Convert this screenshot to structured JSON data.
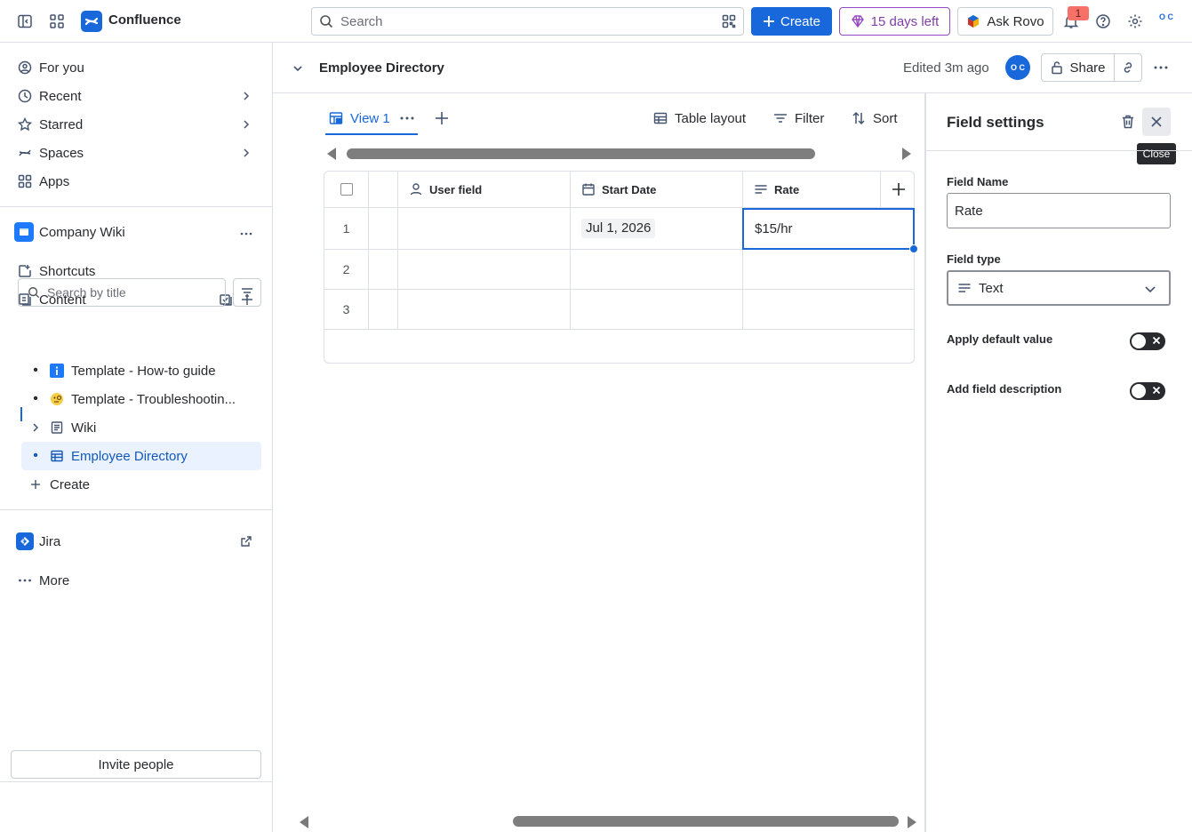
{
  "topbar": {
    "brand": "Confluence",
    "search_placeholder": "Search",
    "create_label": "Create",
    "trial_label": "15 days left",
    "rovo_label": "Ask Rovo",
    "notification_count": "1",
    "avatar_initials": "O C",
    "colors": {
      "primary": "#1868db",
      "trial": "#803fa5",
      "badge": "#f87168"
    }
  },
  "sidebar": {
    "nav": [
      {
        "label": "For you",
        "icon": "user-circle-icon"
      },
      {
        "label": "Recent",
        "icon": "clock-icon"
      },
      {
        "label": "Starred",
        "icon": "star-icon"
      },
      {
        "label": "Spaces",
        "icon": "spaces-icon"
      },
      {
        "label": "Apps",
        "icon": "apps-icon"
      }
    ],
    "space_name": "Company Wiki",
    "shortcuts_label": "Shortcuts",
    "content_label": "Content",
    "search_placeholder": "Search by title",
    "tree": [
      {
        "label": "Template - How-to guide",
        "icon": "info-icon"
      },
      {
        "label": "Template - Troubleshootin...",
        "icon": "emoji-icon"
      },
      {
        "label": "Wiki",
        "icon": "page-icon"
      },
      {
        "label": "Employee Directory",
        "icon": "database-icon",
        "active": true
      }
    ],
    "create_label": "Create",
    "jira_label": "Jira",
    "more_label": "More",
    "invite_label": "Invite people"
  },
  "header": {
    "title": "Employee Directory",
    "edited": "Edited 3m ago",
    "avatar_initials": "O C",
    "share_label": "Share"
  },
  "toolbar": {
    "view_label": "View 1",
    "table_layout_label": "Table layout",
    "filter_label": "Filter",
    "sort_label": "Sort"
  },
  "table": {
    "columns": [
      {
        "label": "User field",
        "icon": "person-icon"
      },
      {
        "label": "Start Date",
        "icon": "calendar-icon"
      },
      {
        "label": "Rate",
        "icon": "text-lines-icon"
      }
    ],
    "rows": [
      {
        "num": "1",
        "user": "",
        "start_date": "Jul 1, 2026",
        "rate": "$15/hr"
      },
      {
        "num": "2",
        "user": "",
        "start_date": "",
        "rate": ""
      },
      {
        "num": "3",
        "user": "",
        "start_date": "",
        "rate": ""
      }
    ]
  },
  "panel": {
    "title": "Field settings",
    "close_tooltip": "Close",
    "field_name_label": "Field Name",
    "field_name_value": "Rate",
    "field_type_label": "Field type",
    "field_type_value": "Text",
    "apply_default_label": "Apply default value",
    "add_description_label": "Add field description"
  }
}
